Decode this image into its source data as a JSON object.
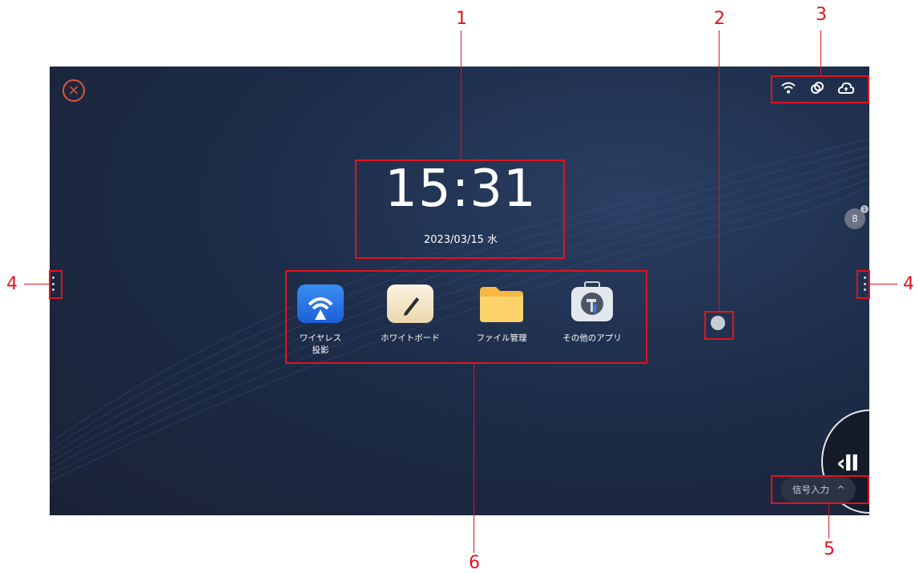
{
  "clock": {
    "time": "15:31",
    "date": "2023/03/15 水"
  },
  "close_button": {
    "icon": "close-icon",
    "symbol": "×"
  },
  "status_icons": [
    "wifi-icon",
    "link-icon",
    "cloud-icon"
  ],
  "apps": [
    {
      "label": "ワイヤレス\n投影",
      "icon": "wireless-projection-icon"
    },
    {
      "label": "ホワイトボード",
      "icon": "whiteboard-icon"
    },
    {
      "label": "ファイル管理",
      "icon": "file-manager-icon"
    },
    {
      "label": "その他のアプリ",
      "icon": "other-apps-icon"
    }
  ],
  "user": {
    "icon": "user-icon",
    "glyph": "8",
    "badge": "1"
  },
  "signal_input": {
    "label": "信号入力",
    "chevron": "^"
  },
  "dock": {
    "glyph": "‹II"
  },
  "callouts": [
    "1",
    "2",
    "3",
    "4",
    "4",
    "5",
    "6"
  ],
  "colors": {
    "annotation": "#e0141e",
    "background": "#1d2c48",
    "close": "#e0553d"
  }
}
